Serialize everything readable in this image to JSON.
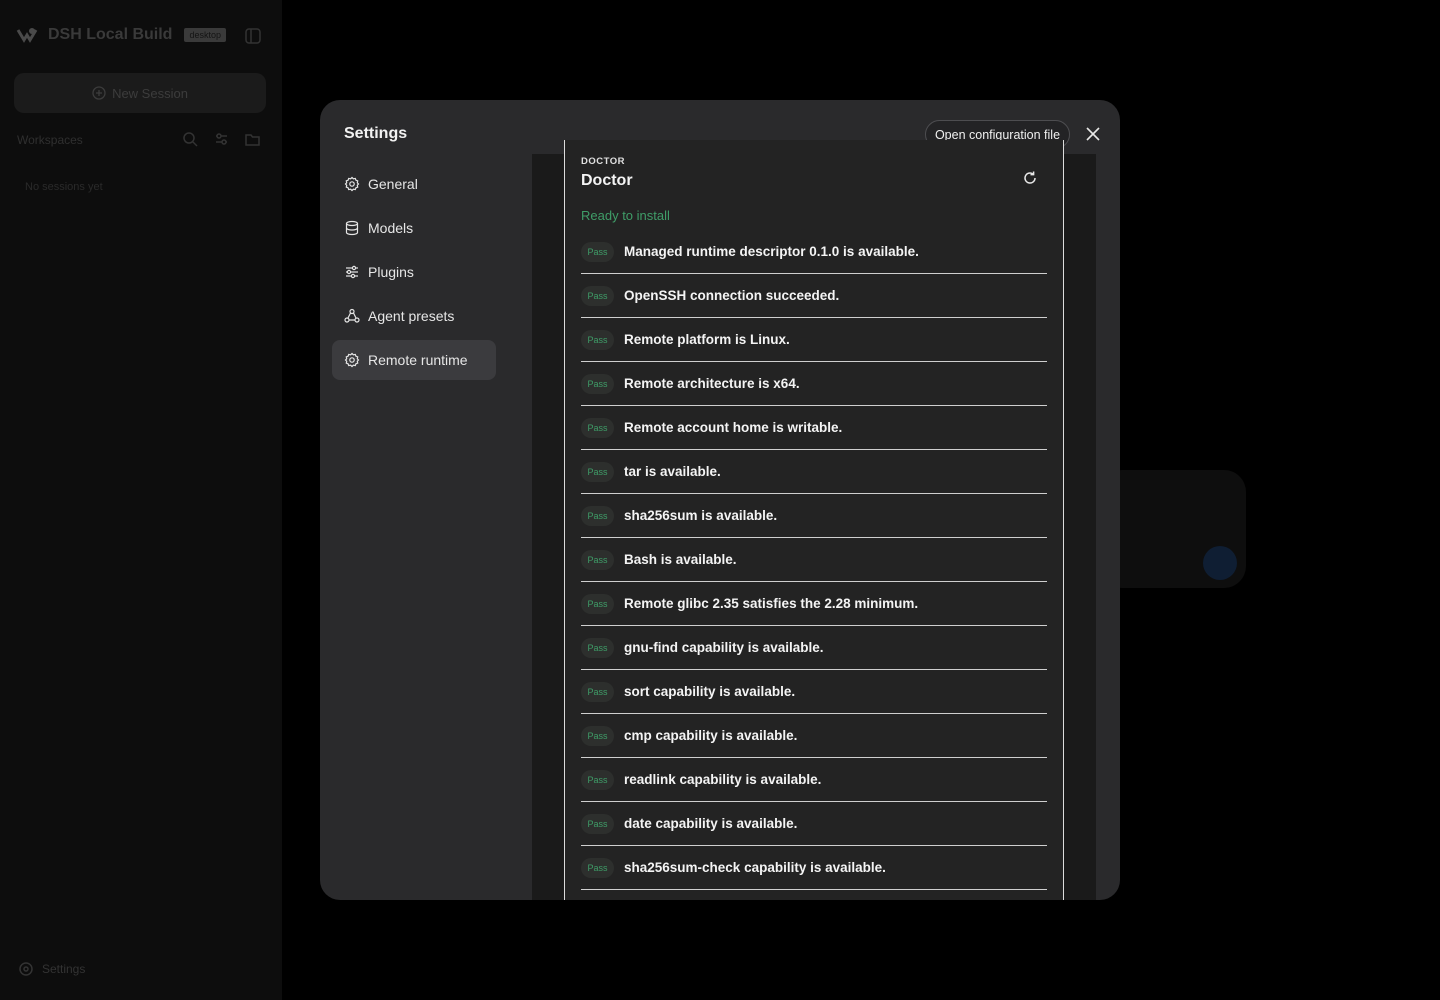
{
  "app": {
    "brand_name": "DSH Local Build",
    "brand_badge": "desktop",
    "new_session_label": "New Session",
    "workspaces_label": "Workspaces",
    "empty_sessions": "No sessions yet",
    "settings_label": "Settings"
  },
  "settings": {
    "title": "Settings",
    "open_config_label": "Open configuration file",
    "nav": [
      {
        "label": "General",
        "icon": "gear-icon"
      },
      {
        "label": "Models",
        "icon": "database-icon"
      },
      {
        "label": "Plugins",
        "icon": "sliders-icon"
      },
      {
        "label": "Agent presets",
        "icon": "presets-icon"
      },
      {
        "label": "Remote runtime",
        "icon": "gear-icon",
        "active": true
      }
    ]
  },
  "doctor": {
    "eyebrow": "Doctor",
    "title": "Doctor",
    "status": "Ready to install",
    "status_color": "#3f9d68",
    "badge_label": "Pass",
    "checks": [
      "Managed runtime descriptor 0.1.0 is available.",
      "OpenSSH connection succeeded.",
      "Remote platform is Linux.",
      "Remote architecture is x64.",
      "Remote account home is writable.",
      "tar is available.",
      "sha256sum is available.",
      "Bash is available.",
      "Remote glibc 2.35 satisfies the 2.28 minimum.",
      "gnu-find capability is available.",
      "sort capability is available.",
      "cmp capability is available.",
      "readlink capability is available.",
      "date capability is available.",
      "sha256sum-check capability is available."
    ]
  }
}
